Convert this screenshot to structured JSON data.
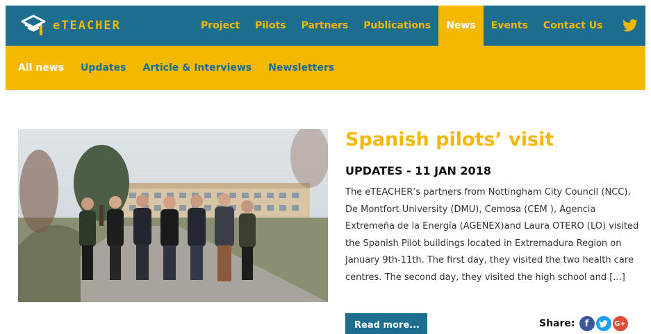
{
  "brand": {
    "name": "eTEACHER"
  },
  "nav": {
    "items": [
      {
        "label": "Project"
      },
      {
        "label": "Pilots"
      },
      {
        "label": "Partners"
      },
      {
        "label": "Publications"
      },
      {
        "label": "News"
      },
      {
        "label": "Events"
      },
      {
        "label": "Contact Us"
      }
    ],
    "active": "News"
  },
  "subnav": {
    "items": [
      {
        "label": "All news"
      },
      {
        "label": "Updates"
      },
      {
        "label": "Article & Interviews"
      },
      {
        "label": "Newsletters"
      }
    ],
    "active": "All news"
  },
  "article": {
    "title": "Spanish pilots’ visit",
    "meta": "UPDATES - 11 JAN 2018",
    "excerpt": "The eTEACHER’s partners from Nottingham City Council (NCC), De Montfort University (DMU), Cemosa (CEM ), Agencia Extremeña de la Energía (AGENEX)and Laura OTERO (LO) visited the Spanish Pilot buildings located in Extremadura Region on January 9th-11th. The first day, they visited the two health care centres. The second day, they visited the high school and [...]",
    "read_more": "Read more...",
    "share_label": "Share:"
  },
  "colors": {
    "primary": "#1c6d8e",
    "accent": "#f4b800",
    "facebook": "#3b5998",
    "twitter": "#1da1f2",
    "googleplus": "#dd4b39"
  },
  "icons": {
    "logo": "eteacher-logo-icon",
    "twitter": "twitter-icon",
    "share": [
      "facebook-icon",
      "twitter-icon",
      "google-plus-icon"
    ]
  }
}
